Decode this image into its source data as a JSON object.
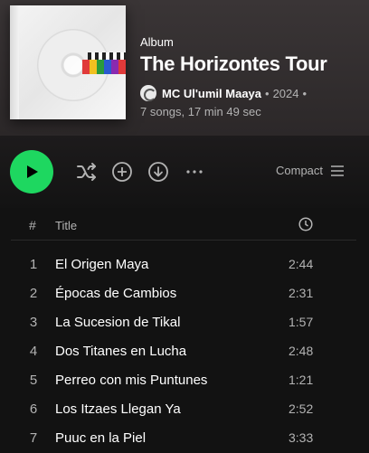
{
  "album": {
    "type_label": "Album",
    "title": "The Horizontes Tour",
    "artist": "MC Ul'umil Maaya",
    "separator": "•",
    "year": "2024",
    "stats": "7 songs, 17 min 49 sec"
  },
  "actions": {
    "view_label": "Compact",
    "icons": [
      "play-icon",
      "shuffle-icon",
      "add-icon",
      "download-icon",
      "more-icon",
      "list-icon"
    ]
  },
  "table": {
    "num_header": "#",
    "title_header": "Title"
  },
  "tracks": [
    {
      "num": "1",
      "title": "El Origen Maya",
      "duration": "2:44"
    },
    {
      "num": "2",
      "title": "Épocas de Cambios",
      "duration": "2:31"
    },
    {
      "num": "3",
      "title": "La Sucesion de Tikal",
      "duration": "1:57"
    },
    {
      "num": "4",
      "title": "Dos Titanes en Lucha",
      "duration": "2:48"
    },
    {
      "num": "5",
      "title": "Perreo con mis Puntunes",
      "duration": "1:21"
    },
    {
      "num": "6",
      "title": "Los Itzaes Llegan Ya",
      "duration": "2:52"
    },
    {
      "num": "7",
      "title": "Puuc en la Piel",
      "duration": "3:33"
    }
  ],
  "colors": {
    "accent": "#1ed760",
    "background": "#121212",
    "secondary_text": "#b3b3b3"
  }
}
